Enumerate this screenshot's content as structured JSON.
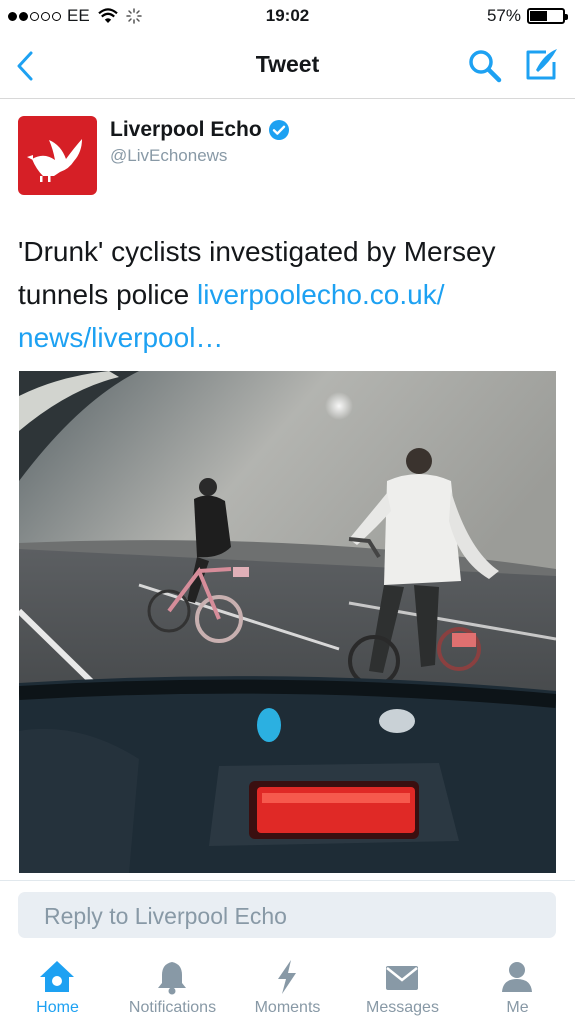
{
  "status": {
    "carrier": "EE",
    "time": "19:02",
    "battery": "57%",
    "battery_level": 0.57
  },
  "nav": {
    "title": "Tweet",
    "back_icon": "chevron-left-icon",
    "search_icon": "search-icon",
    "compose_icon": "compose-icon"
  },
  "tweet": {
    "author_name": "Liverpool Echo",
    "handle": "@LivEchonews",
    "text_plain": "'Drunk' cyclists investigated by Mersey tunnels police ",
    "link_line1": "liverpoolecho.co.uk/",
    "link_line2": "news/liverpool…",
    "verified_icon": "verified-badge-icon",
    "media": "video-still-cyclists-in-tunnel"
  },
  "reply": {
    "placeholder": "Reply to Liverpool Echo"
  },
  "tabs": [
    {
      "label": "Home",
      "icon": "home-icon",
      "active": true
    },
    {
      "label": "Notifications",
      "icon": "bell-icon"
    },
    {
      "label": "Moments",
      "icon": "lightning-icon"
    },
    {
      "label": "Messages",
      "icon": "envelope-icon"
    },
    {
      "label": "Me",
      "icon": "person-icon"
    }
  ],
  "colors": {
    "accent": "#1da1f2",
    "brand_red": "#d61f26",
    "muted": "#8899a6"
  }
}
